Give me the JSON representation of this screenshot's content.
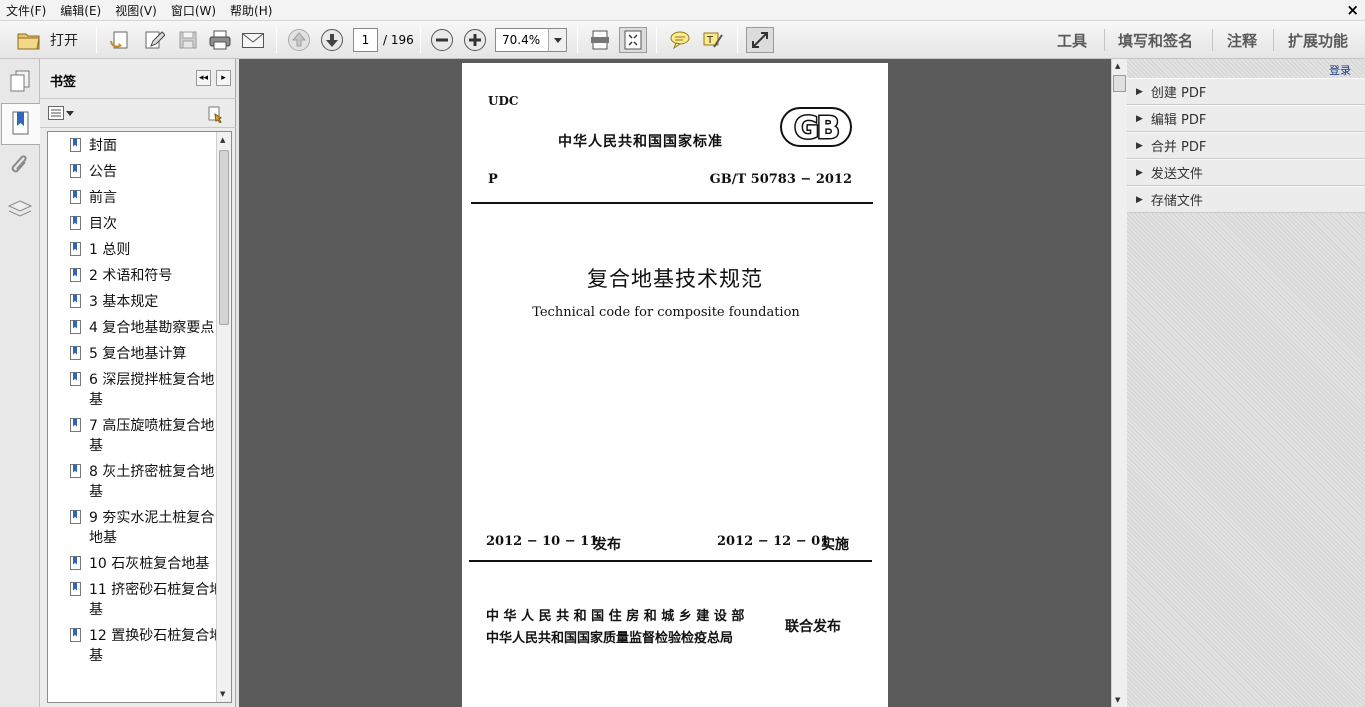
{
  "menubar": {
    "items": [
      "文件(F)",
      "编辑(E)",
      "视图(V)",
      "窗口(W)",
      "帮助(H)"
    ],
    "close": "×"
  },
  "toolbar": {
    "open_label": "打开",
    "page_current": "1",
    "page_total": "/ 196",
    "zoom": "70.4%",
    "right_links": [
      "工具",
      "填写和签名",
      "注释",
      "扩展功能"
    ]
  },
  "bookmarks": {
    "title": "书签",
    "items": [
      "封面",
      "公告",
      "前言",
      "目次",
      "1 总则",
      "2 术语和符号",
      "3 基本规定",
      "4 复合地基勘察要点",
      "5 复合地基计算",
      "6 深层搅拌桩复合地基",
      "7 高压旋喷桩复合地基",
      "8 灰土挤密桩复合地基",
      "9 夯实水泥土桩复合地基",
      "10 石灰桩复合地基",
      "11 挤密砂石桩复合地基",
      "12 置换砂石桩复合地基"
    ]
  },
  "document": {
    "udc": "UDC",
    "standard_type": "中华人民共和国国家标准",
    "gb_logo": "GB",
    "category": "P",
    "code": "GB/T  50783 − 2012",
    "title_cn": "复合地基技术规范",
    "title_en": "Technical code for composite foundation",
    "issue_date": "2012 − 10 − 11",
    "issue_label": "发布",
    "impl_date": "2012 − 12 − 01",
    "impl_label": "实施",
    "publisher_1": "中 华 人 民 共 和 国 住 房 和 城 乡 建 设 部",
    "publisher_2": "中华人民共和国国家质量监督检验检疫总局",
    "joint_label": "联合发布"
  },
  "right_pane": {
    "login": "登录",
    "items": [
      "创建 PDF",
      "编辑 PDF",
      "合并 PDF",
      "发送文件",
      "存储文件"
    ]
  }
}
